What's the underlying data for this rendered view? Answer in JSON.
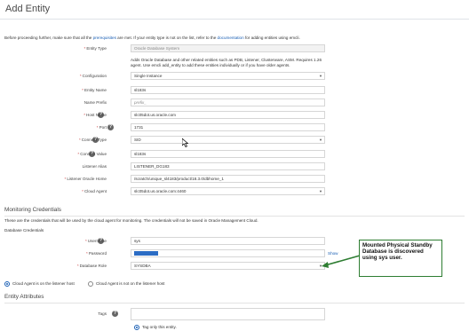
{
  "page": {
    "title": "Add Entity"
  },
  "intro": {
    "before": "Before proceeding further, make sure that all the ",
    "link1": "prerequisites",
    "middle": " are met. If your entity type is not on the list, refer to the ",
    "link2": "documentation",
    "after": " for adding entities using emcli."
  },
  "entity_type": {
    "label": "Entity Type",
    "value": "Oracle Database System"
  },
  "note": {
    "text": "Adds Oracle Database and other related entities such as PDB, Listener, Clusterware, ASM. Requires 1.26 agent. Use emcli add_entity to add these entities individually or if you have older agents."
  },
  "form": {
    "configuration": {
      "label": "Configuration",
      "value": "Single Instance"
    },
    "entity_name": {
      "label": "Entity Name",
      "value": "sl183s"
    },
    "name_prefix": {
      "label": "Name Prefix",
      "value": "prefix_"
    },
    "host_name": {
      "label": "Host Name",
      "value": "slc05dot.us.oracle.com"
    },
    "port": {
      "label": "Port",
      "value": "1731"
    },
    "connect_type": {
      "label": "Connect Type",
      "value": "SID"
    },
    "connect_value": {
      "label": "Connect Value",
      "value": "sl183s"
    },
    "listener_alias": {
      "label": "Listener Alias",
      "value": "LISTENER_DG183"
    },
    "listener_home": {
      "label": "Listener Oracle Home",
      "value": "/scratch/unique_sl4183/product/18.3.0/dbhome_1"
    },
    "cloud_agent": {
      "label": "Cloud Agent",
      "value": "slc05dot.us.oracle.com:4460"
    }
  },
  "monitoring": {
    "title": "Monitoring Credentials",
    "description": "These are the credentials that will be used by the cloud agent for monitoring. The credentials will not be saved in Oracle Management Cloud.",
    "subheading": "Database Credentials",
    "username": {
      "label": "Username",
      "value": "sys"
    },
    "password": {
      "label": "Password",
      "show_label": "Show"
    },
    "database_role": {
      "label": "Database Role",
      "value": "SYSDBA"
    },
    "radio_on_listener": "Cloud Agent is on the listener host",
    "radio_not_on_listener": "Cloud Agent is not on the listener host"
  },
  "attributes": {
    "title": "Entity Attributes",
    "tags_label": "Tags",
    "tag_only": "Tag only this entity."
  },
  "callout": {
    "text": "Mounted Physical Standby Database is discovered using sys user."
  },
  "colors": {
    "link": "#1a5fb4",
    "callout_border": "#2e7d32",
    "arrow": "#2e7d32"
  },
  "icons": {
    "help": "help-icon",
    "dropdown": "chevron-down-icon",
    "cursor": "mouse-cursor-icon"
  }
}
